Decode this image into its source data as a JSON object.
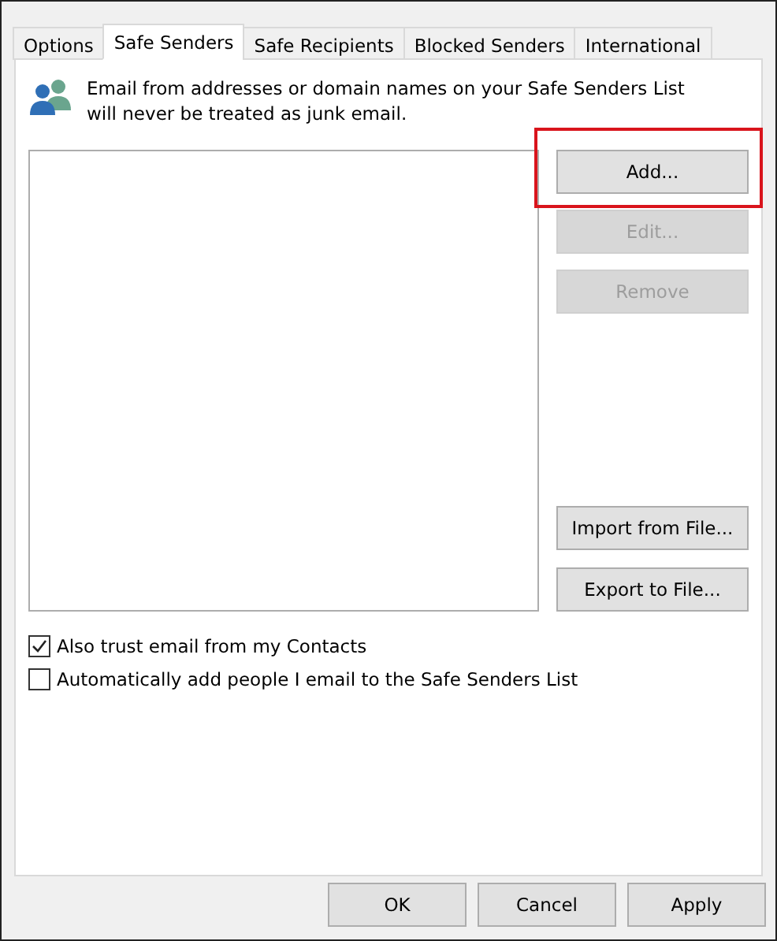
{
  "tabs": [
    {
      "label": "Options",
      "selected": false
    },
    {
      "label": "Safe Senders",
      "selected": true
    },
    {
      "label": "Safe Recipients",
      "selected": false
    },
    {
      "label": "Blocked Senders",
      "selected": false
    },
    {
      "label": "International",
      "selected": false
    }
  ],
  "description": "Email from addresses or domain names on your Safe Senders List will never be treated as junk email.",
  "side_buttons": [
    {
      "label": "Add...",
      "disabled": false,
      "highlighted": true
    },
    {
      "label": "Edit...",
      "disabled": true,
      "highlighted": false
    },
    {
      "label": "Remove",
      "disabled": true,
      "highlighted": false
    }
  ],
  "file_buttons": [
    {
      "label": "Import from File...",
      "disabled": false
    },
    {
      "label": "Export to File...",
      "disabled": false
    }
  ],
  "checkboxes": [
    {
      "label": "Also trust email from my Contacts",
      "checked": true
    },
    {
      "label": "Automatically add people I email to the Safe Senders List",
      "checked": false
    }
  ],
  "dialog_buttons": [
    {
      "label": "OK"
    },
    {
      "label": "Cancel"
    },
    {
      "label": "Apply"
    }
  ]
}
